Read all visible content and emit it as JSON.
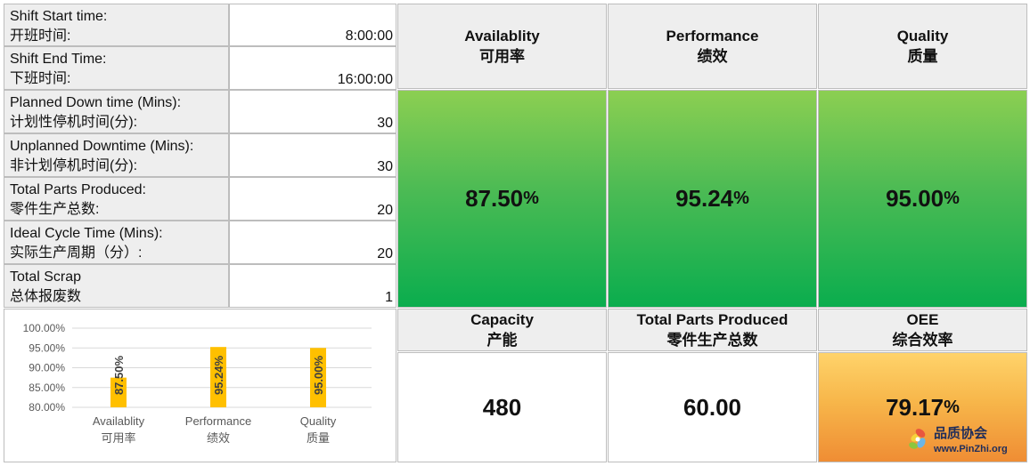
{
  "inputs": [
    {
      "label_en": "Shift Start time:",
      "label_cn": "开班时间:",
      "value": "8:00:00"
    },
    {
      "label_en": "Shift End Time:",
      "label_cn": "下班时间:",
      "value": "16:00:00"
    },
    {
      "label_en": "Planned Down time (Mins):",
      "label_cn": "计划性停机时间(分):",
      "value": "30"
    },
    {
      "label_en": "Unplanned Downtime (Mins):",
      "label_cn": "非计划停机时间(分):",
      "value": "30"
    },
    {
      "label_en": "Total Parts Produced:",
      "label_cn": "零件生产总数:",
      "value": "20"
    },
    {
      "label_en": "Ideal Cycle Time (Mins):",
      "label_cn": "实际生产周期（分）:",
      "value": "20"
    },
    {
      "label_en": "Total Scrap",
      "label_cn": "总体报废数",
      "value": "1"
    }
  ],
  "metrics_top": [
    {
      "label_en": "Availablity",
      "label_cn": "可用率",
      "value": "87.50",
      "unit": "%"
    },
    {
      "label_en": "Performance",
      "label_cn": "绩效",
      "value": "95.24",
      "unit": "%"
    },
    {
      "label_en": "Quality",
      "label_cn": "质量",
      "value": "95.00",
      "unit": "%"
    }
  ],
  "metrics_bottom": [
    {
      "label_en": "Capacity",
      "label_cn": "产能",
      "value": "480",
      "unit": ""
    },
    {
      "label_en": "Total Parts Produced",
      "label_cn": "零件生产总数",
      "value": "60.00",
      "unit": ""
    },
    {
      "label_en": "OEE",
      "label_cn": "综合效率",
      "value": "79.17",
      "unit": "%"
    }
  ],
  "colors": {
    "green_top": "#8ccf52",
    "green_bottom": "#0aad4e",
    "orange_top": "#ffd36a",
    "orange_bottom": "#ef8d34",
    "bar": "#ffc000"
  },
  "logo": {
    "text_cn": "品质协会",
    "text_url": "www.PinZhi.org"
  },
  "chart_data": {
    "type": "bar",
    "categories": [
      "Availablity",
      "Performance",
      "Quality"
    ],
    "categories_cn": [
      "可用率",
      "绩效",
      "质量"
    ],
    "values": [
      87.5,
      95.24,
      95.0
    ],
    "data_labels": [
      "87.50%",
      "95.24%",
      "95.00%"
    ],
    "ylim": [
      80,
      100
    ],
    "yticks": [
      80,
      85,
      90,
      95,
      100
    ],
    "ytick_labels": [
      "80.00%",
      "85.00%",
      "90.00%",
      "95.00%",
      "100.00%"
    ],
    "grid": true,
    "legend": "none",
    "title": "",
    "xlabel": "",
    "ylabel": ""
  }
}
